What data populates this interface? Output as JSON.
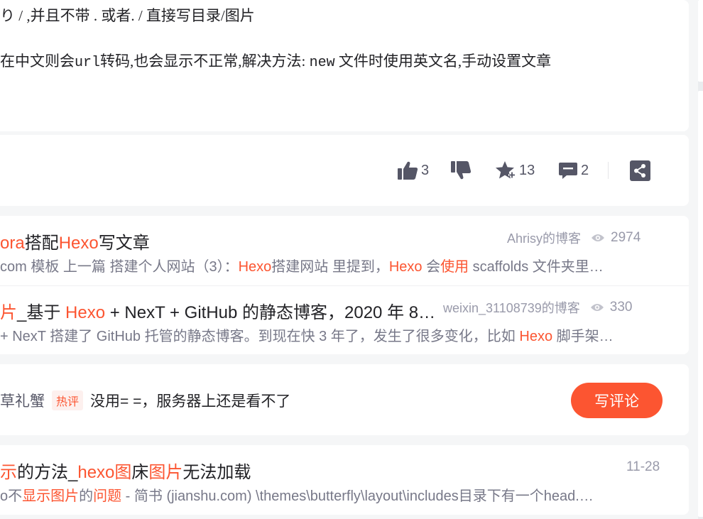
{
  "article": {
    "line1": "り / ,并且不带 . 或者. / 直接写目录/图片",
    "line2_a": "在中文则会",
    "line2_url": "url",
    "line2_b": "转码,也会显示不正常,解决方法: ",
    "line2_new": "new",
    "line2_c": " 文件时使用英文名,手动设置文章"
  },
  "toolbar": {
    "like_count": "3",
    "favorite_count": "13",
    "comment_count": "2"
  },
  "recommendations": [
    {
      "title_parts": [
        {
          "text": "ora",
          "hl": true
        },
        {
          "text": "搭配",
          "hl": false
        },
        {
          "text": "Hexo",
          "hl": true
        },
        {
          "text": "写文章",
          "hl": false
        }
      ],
      "author": "Ahrisy的博客",
      "views": "2974",
      "desc_parts": [
        {
          "text": "com 模板 上一篇 搭建个人网站（3）：",
          "hl": false
        },
        {
          "text": "Hexo",
          "hl": true
        },
        {
          "text": "搭建网站 里提到，",
          "hl": false
        },
        {
          "text": "Hexo",
          "hl": true
        },
        {
          "text": " 会",
          "hl": false
        },
        {
          "text": "使用",
          "hl": true
        },
        {
          "text": " scaffolds 文件夹里…",
          "hl": false
        }
      ]
    },
    {
      "title_parts": [
        {
          "text": "片",
          "hl": true
        },
        {
          "text": "_基于 ",
          "hl": false
        },
        {
          "text": "Hexo",
          "hl": true
        },
        {
          "text": " + NexT + GitHub 的静态博客，2020 年 8…",
          "hl": false
        }
      ],
      "author": "weixin_31108739的博客",
      "views": "330",
      "desc_parts": [
        {
          "text": "+ NexT 搭建了 GitHub 托管的静态博客。到现在快 3 年了，发生了很多变化，比如 ",
          "hl": false
        },
        {
          "text": "Hexo",
          "hl": true
        },
        {
          "text": " 脚手架…",
          "hl": false
        }
      ]
    }
  ],
  "comment": {
    "user": "草礼蟹",
    "badge": "热评",
    "text": "没用= =，服务器上还是看不了",
    "write_button": "写评论"
  },
  "bottom_item": {
    "title_parts": [
      {
        "text": "示",
        "hl": true
      },
      {
        "text": "的方法_",
        "hl": false
      },
      {
        "text": "hexo",
        "hl": true
      },
      {
        "text": "图",
        "hl": true
      },
      {
        "text": "床",
        "hl": false
      },
      {
        "text": "图片",
        "hl": true
      },
      {
        "text": "无法加载",
        "hl": false
      }
    ],
    "date": "11-28",
    "desc_parts": [
      {
        "text": "o不",
        "hl": false
      },
      {
        "text": "显示图片",
        "hl": true
      },
      {
        "text": "的",
        "hl": false
      },
      {
        "text": "问题",
        "hl": true
      },
      {
        "text": " - 简书 (jianshu.com) \\themes\\butterfly\\layout\\includes目录下有一个head.…",
        "hl": false
      }
    ]
  },
  "colors": {
    "accent": "#fc5531",
    "text": "#222226",
    "muted": "#999aaa"
  }
}
